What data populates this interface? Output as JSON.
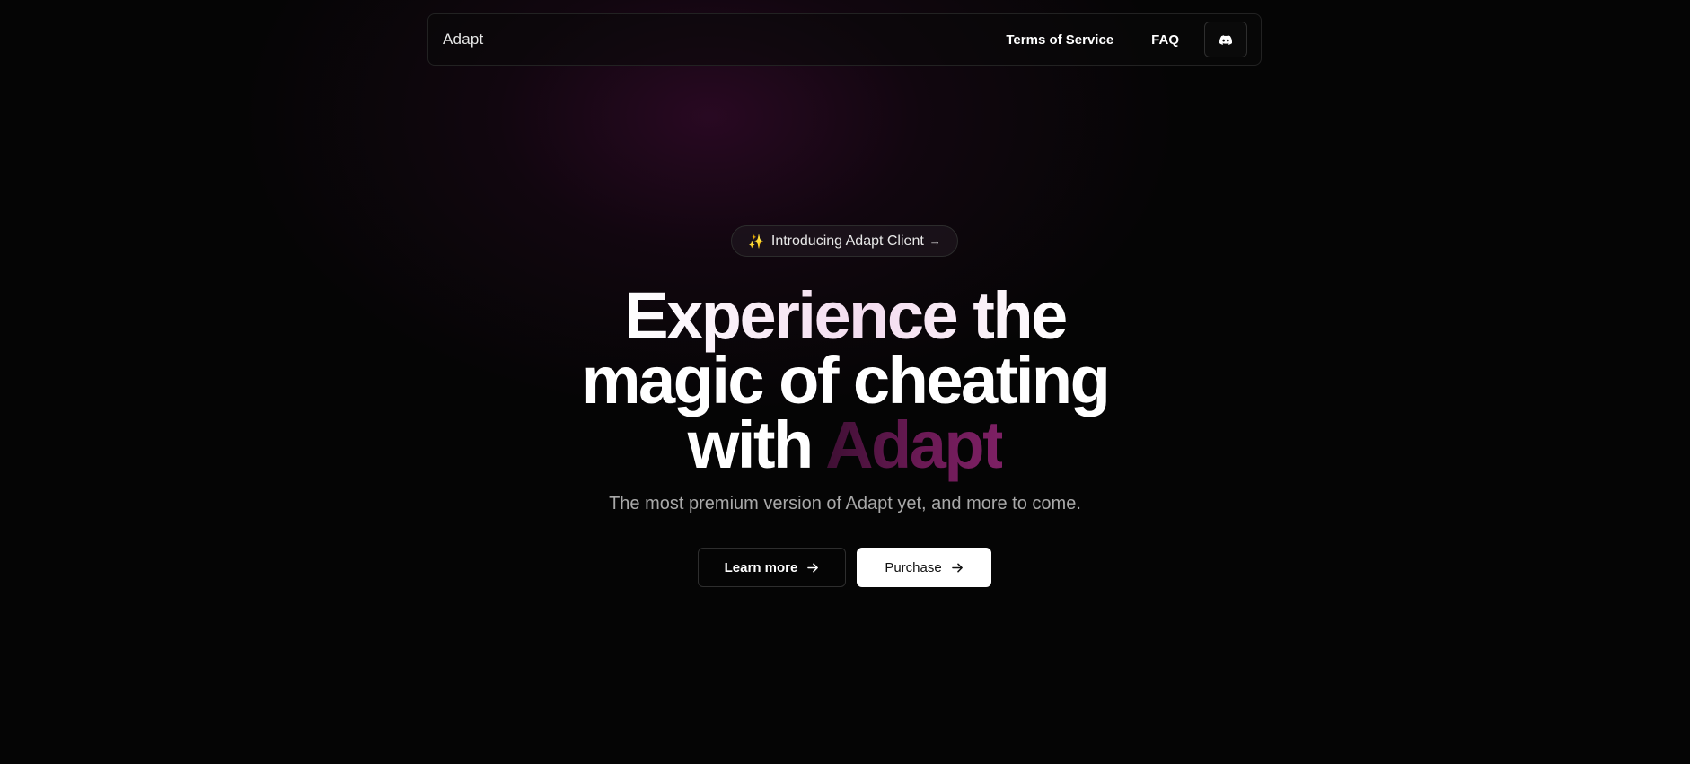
{
  "nav": {
    "brand": "Adapt",
    "links": [
      {
        "label": "Terms of Service"
      },
      {
        "label": "FAQ"
      }
    ],
    "discord_icon": "discord-icon"
  },
  "hero": {
    "announcement": {
      "sparkle": "✨",
      "text": "Introducing Adapt Client",
      "arrow": "→"
    },
    "headline": {
      "line1": "Experience the",
      "line2": "magic of cheating",
      "line3_prefix": "with",
      "line3_accent": "Adapt"
    },
    "subtitle": "The most premium version of Adapt yet, and more to come.",
    "buttons": {
      "learn_more": "Learn more",
      "purchase": "Purchase"
    }
  },
  "colors": {
    "background": "#050505",
    "accent": "#6b1a55",
    "glow": "#3a0a30"
  }
}
